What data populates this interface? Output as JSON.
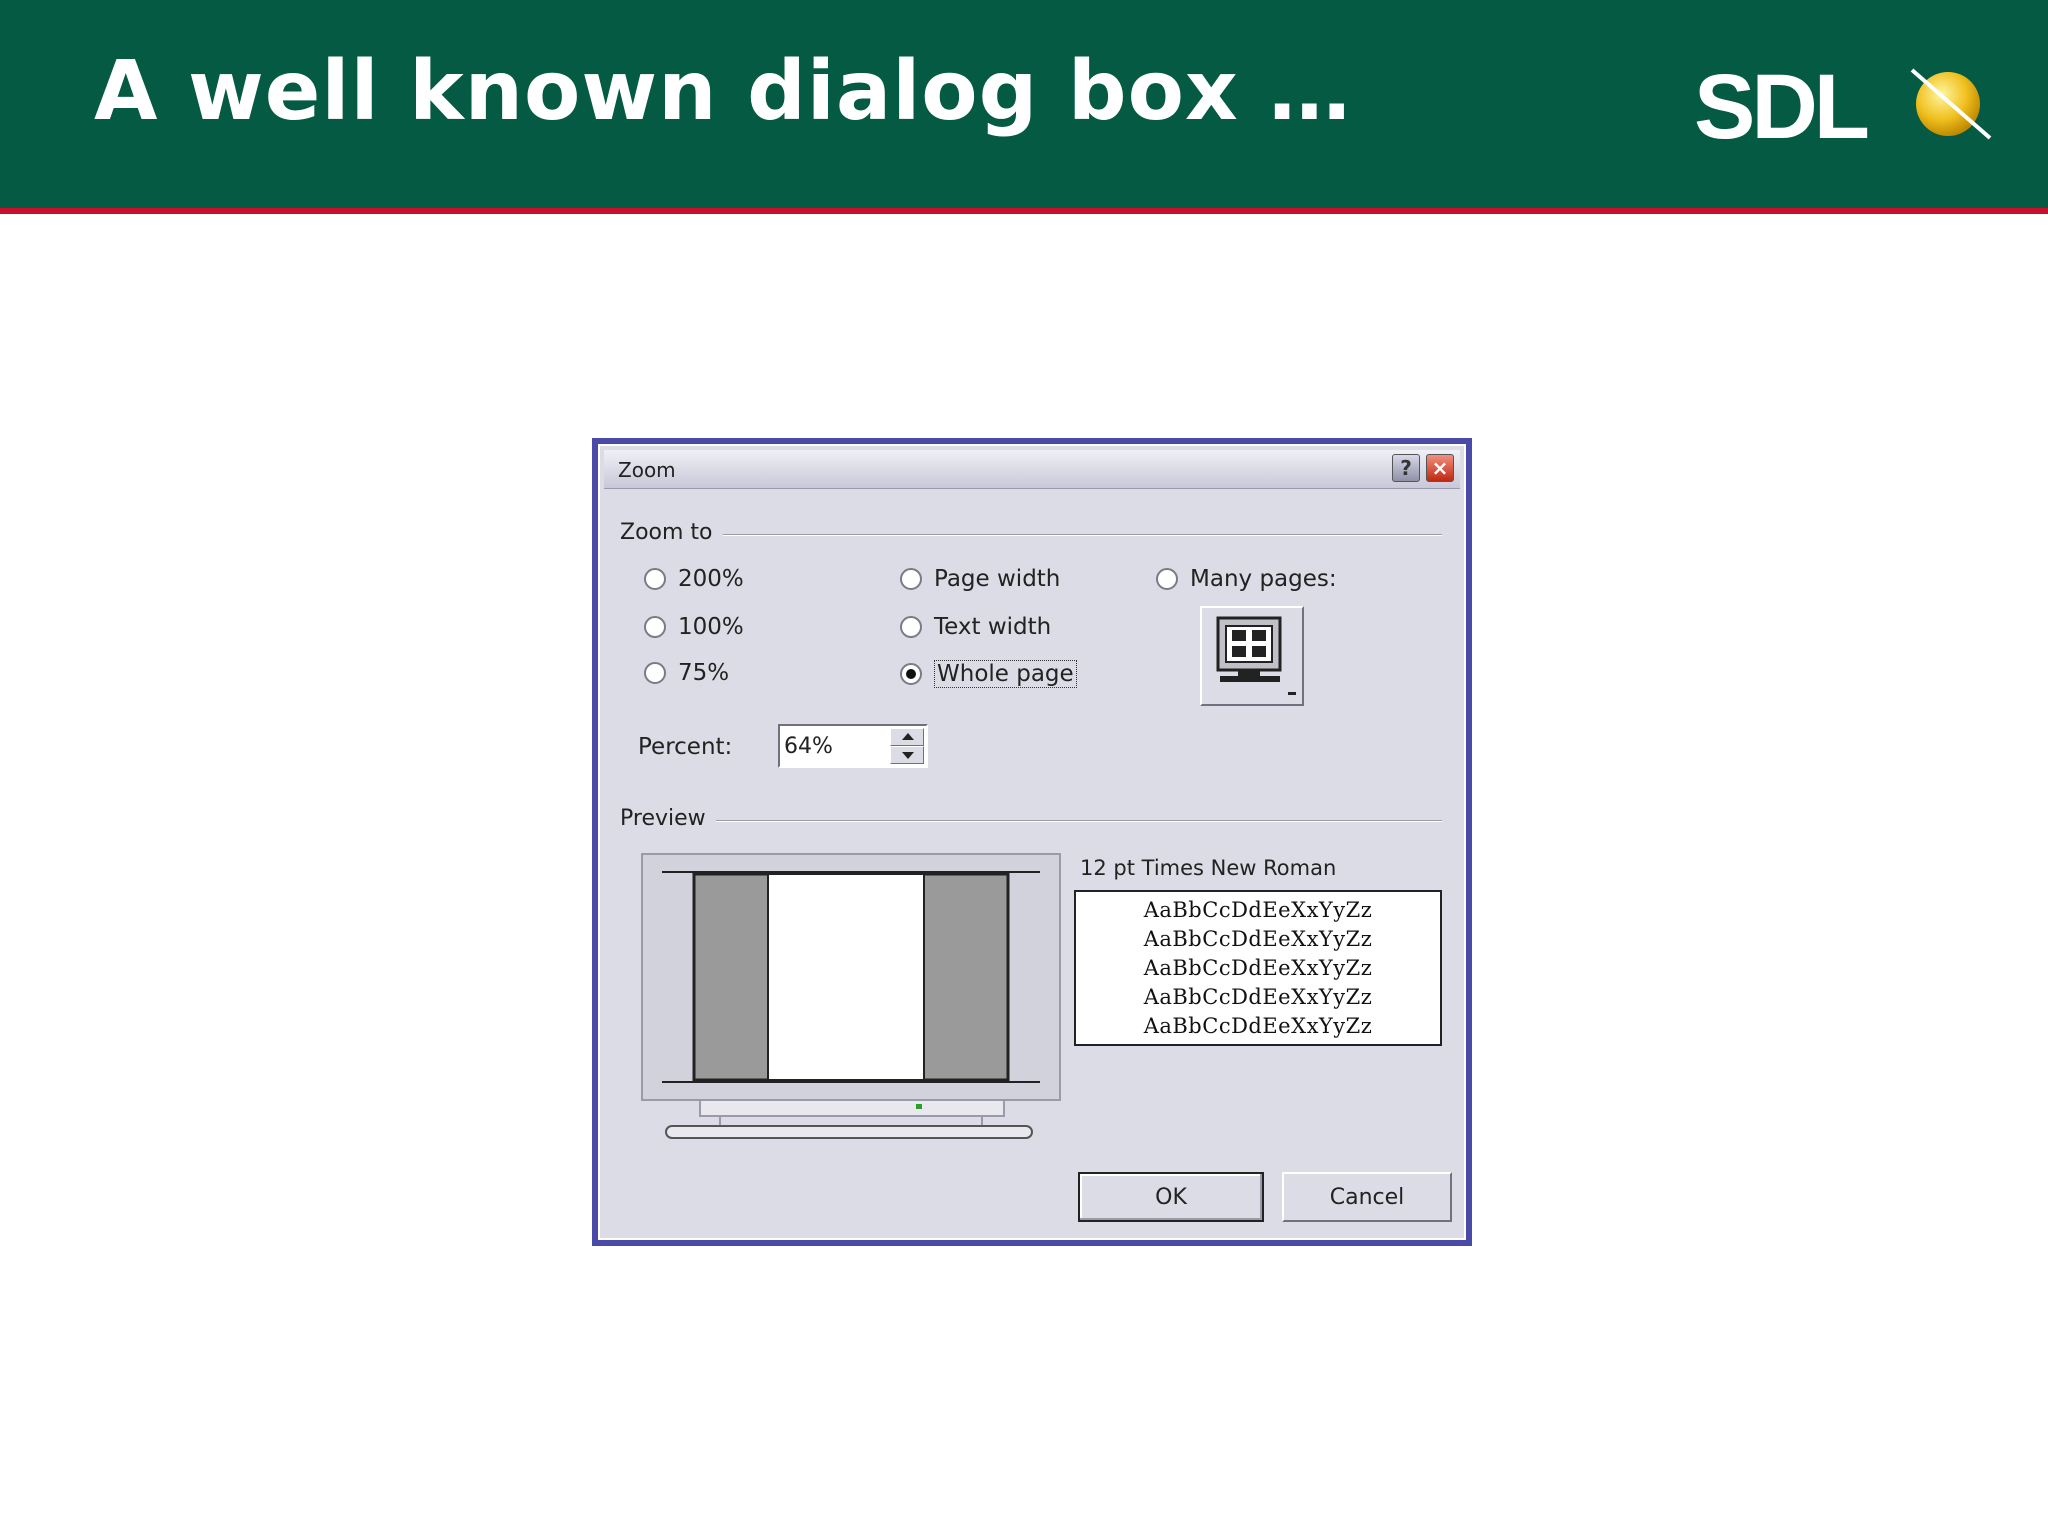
{
  "slide": {
    "title": "A well known dialog box …",
    "logo_text": "SDL"
  },
  "colors": {
    "header": "#045a42",
    "accent_line": "#c8102e",
    "dialog_frame": "#4a4aa8",
    "dialog_face": "#dcdce6"
  },
  "dialog": {
    "title": "Zoom",
    "help_label": "?",
    "close_label": "×",
    "zoom_group_label": "Zoom to",
    "radios": {
      "r200": {
        "label": "200%",
        "checked": false
      },
      "r100": {
        "label": "100%",
        "checked": false
      },
      "r75": {
        "label": "75%",
        "checked": false
      },
      "page_width": {
        "label": "Page width",
        "checked": false
      },
      "text_width": {
        "label": "Text width",
        "checked": false
      },
      "whole_page": {
        "label": "Whole page",
        "checked": true
      },
      "many_pages": {
        "label": "Many pages:",
        "checked": false
      }
    },
    "percent": {
      "label": "Percent:",
      "value": "64%"
    },
    "preview_group_label": "Preview",
    "font_label": "12 pt Times New Roman",
    "sample_lines": [
      "AaBbCcDdEeXxYyZz",
      "AaBbCcDdEeXxYyZz",
      "AaBbCcDdEeXxYyZz",
      "AaBbCcDdEeXxYyZz",
      "AaBbCcDdEeXxYyZz"
    ],
    "ok_label": "OK",
    "cancel_label": "Cancel"
  }
}
